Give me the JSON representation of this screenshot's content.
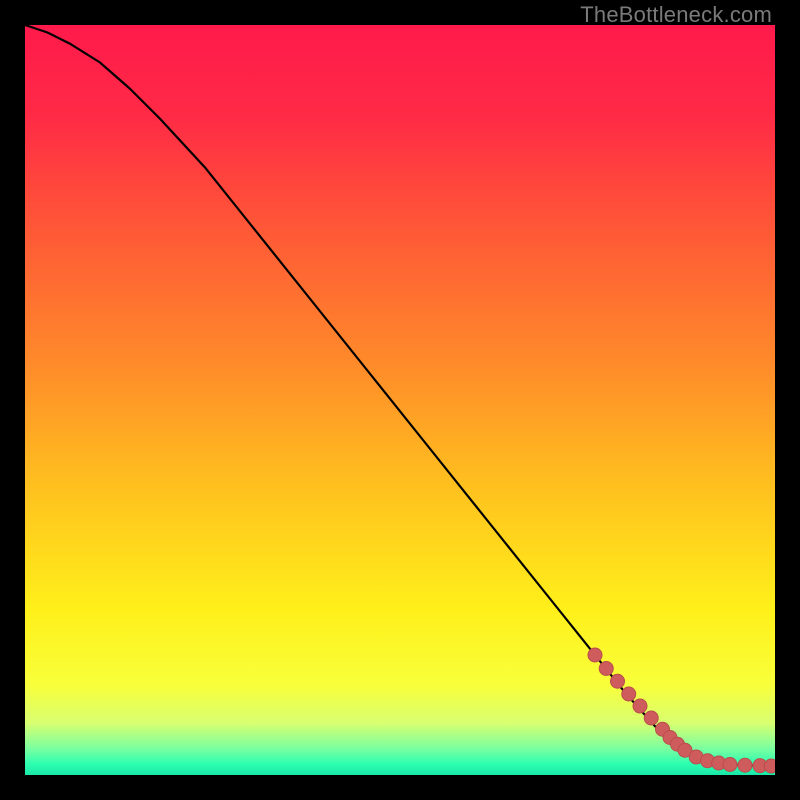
{
  "watermark": "TheBottleneck.com",
  "colors": {
    "gradient_stops": [
      {
        "offset": 0.0,
        "color": "#ff1a4b"
      },
      {
        "offset": 0.12,
        "color": "#ff2a46"
      },
      {
        "offset": 0.28,
        "color": "#ff5a36"
      },
      {
        "offset": 0.45,
        "color": "#ff8a2a"
      },
      {
        "offset": 0.62,
        "color": "#ffc21e"
      },
      {
        "offset": 0.78,
        "color": "#fff01a"
      },
      {
        "offset": 0.88,
        "color": "#f8ff3a"
      },
      {
        "offset": 0.93,
        "color": "#d9ff70"
      },
      {
        "offset": 0.965,
        "color": "#7affa0"
      },
      {
        "offset": 0.985,
        "color": "#2effb0"
      },
      {
        "offset": 1.0,
        "color": "#18e8a8"
      }
    ],
    "line": "#000000",
    "marker_fill": "#cf5c5c",
    "marker_stroke": "#b94c4c",
    "background": "#000000"
  },
  "chart_data": {
    "type": "line",
    "title": "",
    "xlabel": "",
    "ylabel": "",
    "xlim": [
      0,
      100
    ],
    "ylim": [
      0,
      100
    ],
    "series": [
      {
        "name": "curve",
        "x": [
          0,
          3,
          6,
          10,
          14,
          18,
          24,
          30,
          38,
          46,
          54,
          62,
          70,
          76,
          80,
          84,
          88,
          92,
          96,
          100
        ],
        "y": [
          100,
          99,
          97.5,
          95,
          91.5,
          87.5,
          81,
          73.5,
          63.5,
          53.5,
          43.5,
          33.5,
          23.5,
          16,
          11,
          6.5,
          3.2,
          1.6,
          1.3,
          1.2
        ]
      }
    ],
    "markers": {
      "name": "highlighted-points",
      "x": [
        76,
        77.5,
        79,
        80.5,
        82,
        83.5,
        85,
        86,
        87,
        88,
        89.5,
        91,
        92.5,
        94,
        96,
        98,
        99.5
      ],
      "y": [
        16,
        14.2,
        12.5,
        10.8,
        9.2,
        7.6,
        6.1,
        5,
        4.1,
        3.3,
        2.4,
        1.9,
        1.6,
        1.4,
        1.3,
        1.25,
        1.2
      ]
    }
  }
}
